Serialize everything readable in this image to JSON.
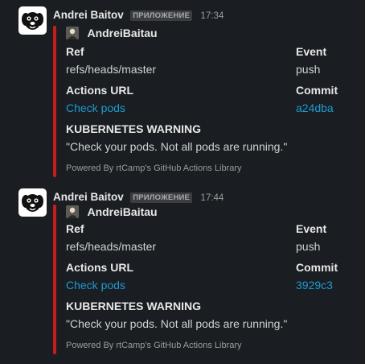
{
  "messages": [
    {
      "sender": "Andrei Baitov",
      "badge": "ПРИЛОЖЕНИЕ",
      "time": "17:34",
      "author": "AndreiBaitau",
      "fields": [
        {
          "title": "Ref",
          "value": "refs/heads/master"
        },
        {
          "title": "Event",
          "value": "push"
        },
        {
          "title": "Actions URL",
          "value": "Check pods"
        },
        {
          "title": "Commit",
          "value": "a24dba"
        }
      ],
      "warning_title": "KUBERNETES WARNING",
      "warning_text": "\"Check your pods. Not all pods are running.\"",
      "footer": "Powered By rtCamp's GitHub Actions Library",
      "accent_color": "#c81d1d"
    },
    {
      "sender": "Andrei Baitov",
      "badge": "ПРИЛОЖЕНИЕ",
      "time": "17:44",
      "author": "AndreiBaitau",
      "fields": [
        {
          "title": "Ref",
          "value": "refs/heads/master"
        },
        {
          "title": "Event",
          "value": "push"
        },
        {
          "title": "Actions URL",
          "value": "Check pods"
        },
        {
          "title": "Commit",
          "value": "3929c3"
        }
      ],
      "warning_title": "KUBERNETES WARNING",
      "warning_text": "\"Check your pods. Not all pods are running.\"",
      "footer": "Powered By rtCamp's GitHub Actions Library",
      "accent_color": "#c81d1d"
    }
  ],
  "icons": {
    "app_avatar": "dog-avatar-icon",
    "author_avatar": "author-avatar-icon"
  },
  "colors": {
    "background": "#1a1d21",
    "link": "#1d9bd1",
    "attachment_bar": "#c81d1d"
  }
}
